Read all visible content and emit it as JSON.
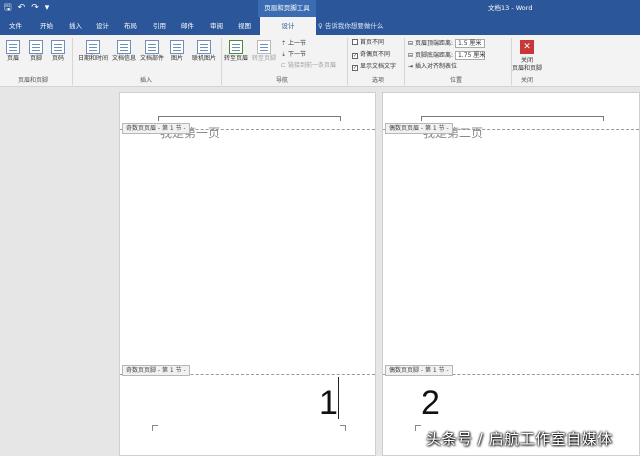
{
  "qat": {
    "save": "🖫",
    "undo": "↶",
    "redo": "↷",
    "more": "▾"
  },
  "context_title": "页眉和页脚工具",
  "doc_title": "文档13  -  Word",
  "tabs": [
    {
      "label": "文件"
    },
    {
      "label": "开始"
    },
    {
      "label": "插入"
    },
    {
      "label": "设计"
    },
    {
      "label": "布局"
    },
    {
      "label": "引用"
    },
    {
      "label": "邮件"
    },
    {
      "label": "审阅"
    },
    {
      "label": "视图"
    },
    {
      "label": "设计"
    }
  ],
  "tellme": "告诉我你想要做什么",
  "ribbon": {
    "hf_group": {
      "label": "页眉和页脚",
      "header": "页眉",
      "footer": "页脚",
      "pagenum": "页码"
    },
    "insert_group": {
      "label": "插入",
      "datetime": "日期和时间",
      "docinfo": "文档信息",
      "docparts": "文档部件",
      "picture": "图片",
      "onlinepic": "联机图片"
    },
    "nav_group": {
      "label": "导航",
      "goto_header": "转至页眉",
      "goto_footer": "转至页脚",
      "prev": "上一节",
      "next": "下一节",
      "link_prev": "链接到前一条页眉"
    },
    "options_group": {
      "label": "选项",
      "first_page": "首页不同",
      "odd_even": "奇偶页不同",
      "show_text": "显示文档文字"
    },
    "position_group": {
      "label": "位置",
      "header_top": "页眉顶端距离:",
      "header_top_val": "1.5 厘米",
      "footer_bottom": "页脚底端距离:",
      "footer_bottom_val": "1.75 厘米",
      "insert_align": "插入对齐制表位"
    },
    "close_group": {
      "label": "关闭",
      "close1": "关闭",
      "close2": "页眉和页脚"
    }
  },
  "pages": [
    {
      "header_tag": "奇数页页眉 - 第 1 节 -",
      "header_text": "我是第一页",
      "footer_tag": "奇数页页脚 - 第 1 节 -",
      "page_number": "1"
    },
    {
      "header_tag": "偶数页页眉 - 第 1 节 -",
      "header_text": "我是第二页",
      "footer_tag": "偶数页页脚 - 第 1 节 -",
      "page_number": "2"
    }
  ],
  "watermark": "头条号 / 启航工作室自媒体"
}
